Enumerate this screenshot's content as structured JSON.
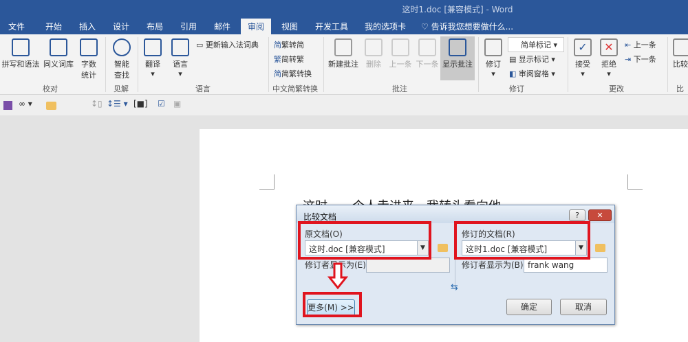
{
  "window": {
    "title": "这时1.doc [兼容模式] - Word"
  },
  "tabs": [
    "文件",
    "开始",
    "插入",
    "设计",
    "布局",
    "引用",
    "邮件",
    "审阅",
    "视图",
    "开发工具",
    "我的选项卡"
  ],
  "tell_me": "告诉我您想要做什么...",
  "ribbon": {
    "proofing": {
      "spell": "拼写和语法",
      "thesaurus": "同义词库",
      "wordcount_1": "字数",
      "wordcount_2": "统计",
      "label": "校对"
    },
    "insights": {
      "smart_1": "智能",
      "smart_2": "查找",
      "label": "见解"
    },
    "language": {
      "translate": "翻译",
      "language": "语言",
      "update_ime": "更新输入法词典",
      "label": "语言"
    },
    "chinese": {
      "to_simp": "繁转简",
      "to_trad": "简转繁",
      "convert": "简繁转换",
      "label": "中文简繁转换"
    },
    "comments": {
      "new": "新建批注",
      "delete": "删除",
      "prev": "上一条",
      "next": "下一条",
      "show": "显示批注",
      "label": "批注"
    },
    "tracking": {
      "track": "修订",
      "markup": "简单标记",
      "show_markup": "显示标记",
      "pane": "审阅窗格",
      "label": "修订"
    },
    "changes": {
      "accept": "接受",
      "reject": "拒绝",
      "prev": "上一条",
      "next": "下一条",
      "label": "更改"
    },
    "compare": {
      "compare": "比较",
      "label": "比较"
    }
  },
  "document": {
    "text": "这时，一个人走进来，我转头看向他。"
  },
  "dialog": {
    "title": "比较文档",
    "help": "?",
    "close": "✕",
    "original_label": "原文档(O)",
    "original_value": "这时.doc [兼容模式]",
    "revised_label": "修订的文档(R)",
    "revised_value": "这时1.doc [兼容模式]",
    "label_changes_orig": "修订者显示为(E)",
    "label_changes_orig_value": "",
    "label_changes_rev": "修订者显示为(B)",
    "label_changes_rev_value": "frank wang",
    "swap": "⇆",
    "more": "更多(M) >>",
    "ok": "确定",
    "cancel": "取消"
  },
  "colors": {
    "accent": "#2b579a",
    "highlight": "#e0141e"
  }
}
